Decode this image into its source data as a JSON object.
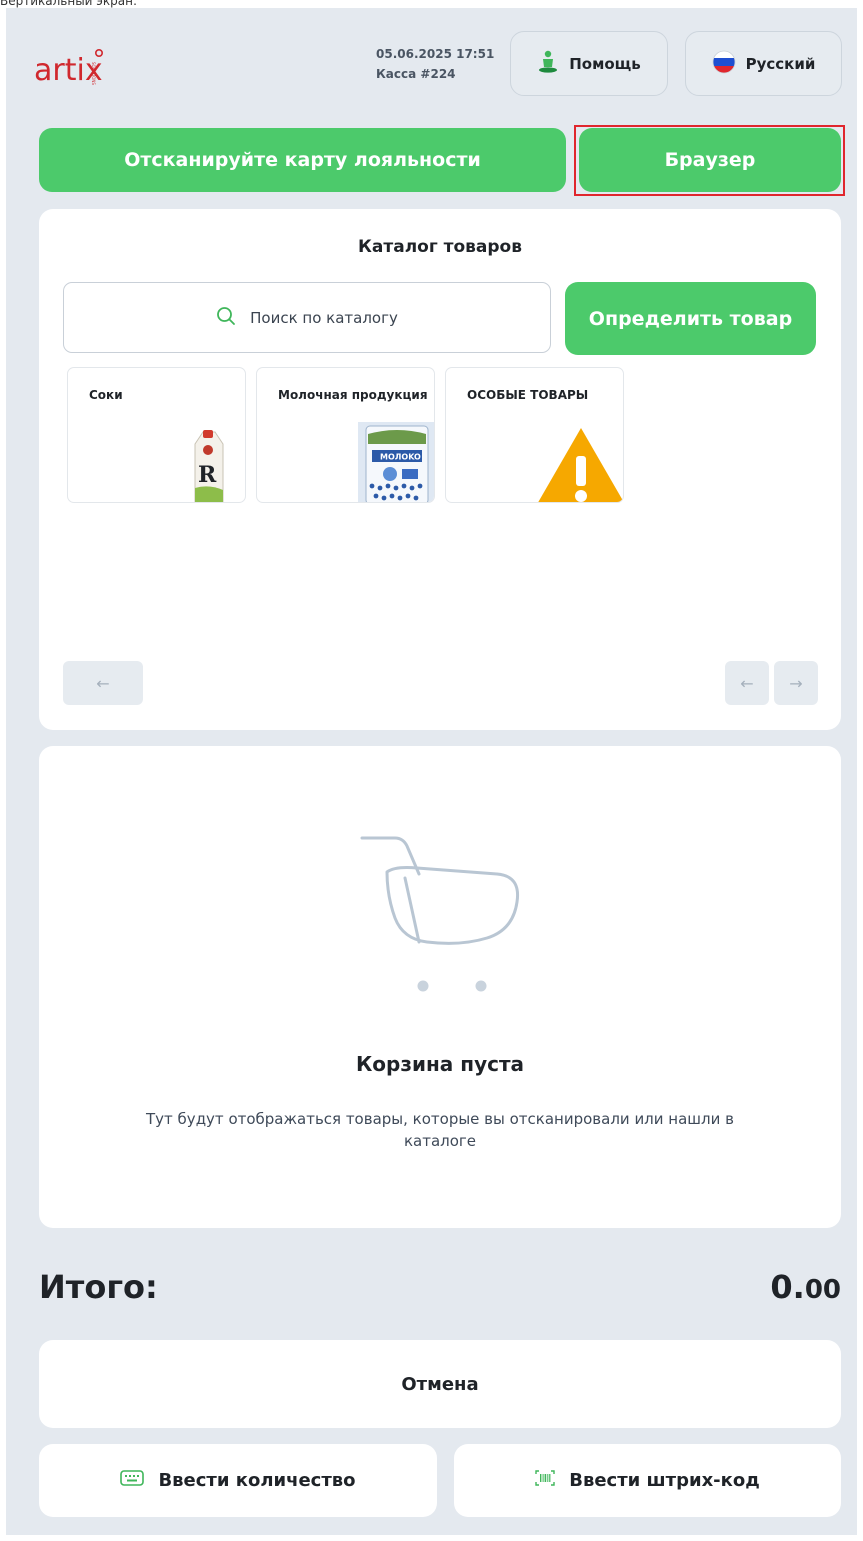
{
  "caption": "Вертикальный экран:",
  "header": {
    "logo_text": "artix",
    "logo_sub": "SOLUTIONS",
    "datetime": "05.06.2025 17:51",
    "register": "Касса #224",
    "help_label": "Помощь",
    "language_label": "Русский"
  },
  "actions": {
    "loyalty_label": "Отсканируйте карту лояльности",
    "browser_label": "Браузер"
  },
  "catalog": {
    "title": "Каталог товаров",
    "search_placeholder": "Поиск по каталогу",
    "identify_label": "Определить товар",
    "categories": [
      {
        "label": "Соки",
        "icon": "juice-carton-image"
      },
      {
        "label": "Молочная продукция",
        "icon": "milk-package-image"
      },
      {
        "label": "ОСОБЫЕ ТОВАРЫ",
        "icon": "warning-triangle-image"
      }
    ]
  },
  "cart": {
    "title": "Корзина пуста",
    "description": "Тут будут отображаться товары, которые вы отсканировали или нашли в каталоге"
  },
  "total": {
    "label": "Итого:",
    "amount_main": "0.",
    "amount_cents": "00"
  },
  "bottom": {
    "cancel_label": "Отмена",
    "quantity_label": "Ввести количество",
    "barcode_label": "Ввести штрих-код"
  },
  "colors": {
    "accent_green": "#4cca6b",
    "logo_red": "#d0282e",
    "background": "#e4e9ef",
    "highlight_red": "#e0262d"
  }
}
